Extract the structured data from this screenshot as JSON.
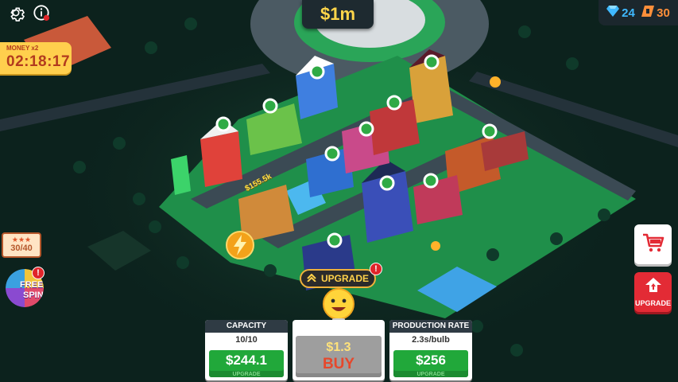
{
  "hud": {
    "money": "$1m",
    "gems": "24",
    "tickets": "30",
    "boost_label": "MONEY x2",
    "boost_timer": "02:18:17"
  },
  "left": {
    "ticket_progress": "30/40",
    "free_spin_line1": "FREE",
    "free_spin_line2": "SPIN",
    "alert_mark": "!"
  },
  "right": {
    "upgrade_label": "UPGRADE"
  },
  "world": {
    "floating_income": "$155.5k",
    "upgrade_pill": "UPGRADE",
    "alert_mark": "!"
  },
  "bottom": {
    "capacity": {
      "title": "CAPACITY",
      "value": "10/10",
      "price": "$244.1",
      "caption": "UPGRADE"
    },
    "buy": {
      "price": "$1.3",
      "label": "BUY"
    },
    "production": {
      "title": "PRODUCTION RATE",
      "value": "2.3s/bulb",
      "price": "$256",
      "caption": "UPGRADE"
    }
  },
  "colors": {
    "grass": "#1f8f4a",
    "road": "#3b4a54",
    "accent_yellow": "#ffd54a",
    "button_green": "#21a83a",
    "button_red": "#e32b35"
  },
  "icons": [
    "gear-icon",
    "info-icon",
    "diamond-icon",
    "ticket-icon",
    "cart-icon",
    "house-arrow-icon",
    "lightning-icon",
    "bulb-icon",
    "chevron-up-icon"
  ]
}
